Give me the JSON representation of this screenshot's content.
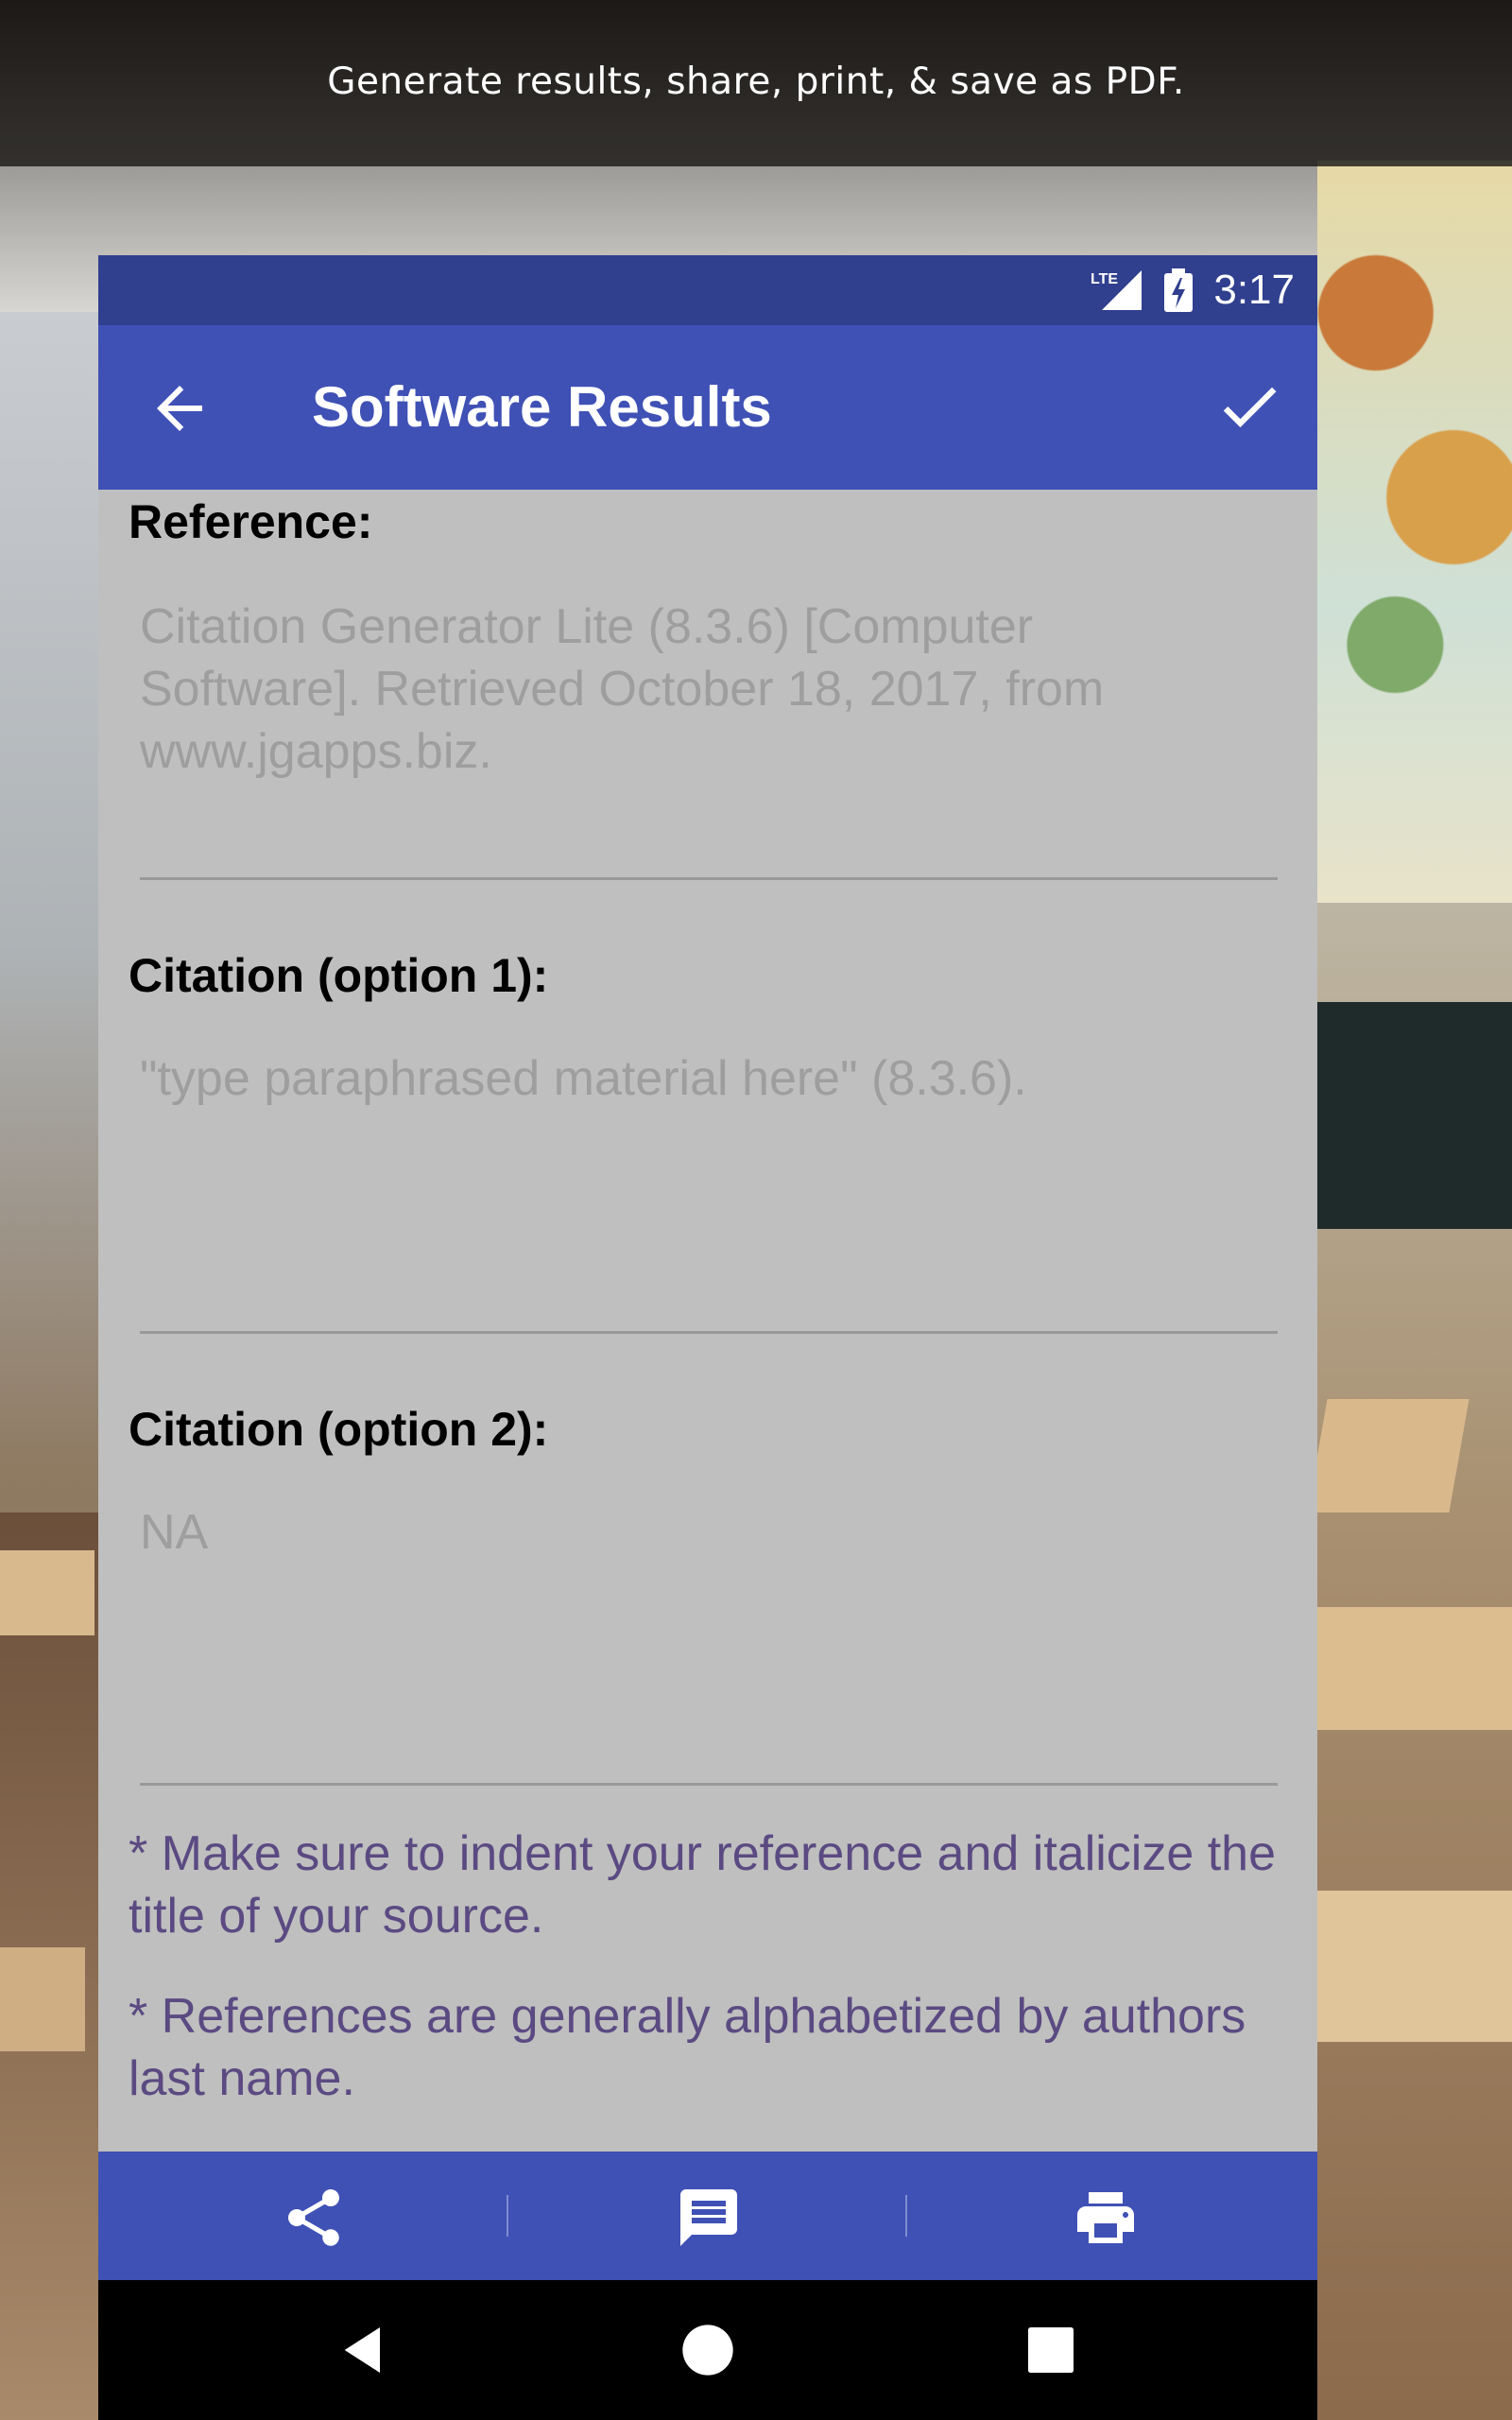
{
  "caption": "Generate results, share, print, & save as PDF.",
  "status_bar": {
    "network": "LTE",
    "time": "3:17"
  },
  "app_bar": {
    "title": "Software Results"
  },
  "sections": [
    {
      "label": "Reference:",
      "value": "Citation Generator Lite (8.3.6) [Computer Software]. Retrieved October 18, 2017, from www.jgapps.biz."
    },
    {
      "label": "Citation (option 1):",
      "value": "\"type paraphrased material here\" (8.3.6)."
    },
    {
      "label": "Citation (option 2):",
      "value": "NA"
    }
  ],
  "notes": [
    "* Make sure to indent your reference and italicize the title of your source.",
    "* References are generally alphabetized by authors last name."
  ],
  "bottom_actions": [
    "share-icon",
    "message-icon",
    "print-icon"
  ],
  "colors": {
    "primary": "#3f51b5",
    "primary_dark": "#303f8e",
    "note_text": "#5b4a82",
    "content_bg": "#bfbfbf"
  }
}
